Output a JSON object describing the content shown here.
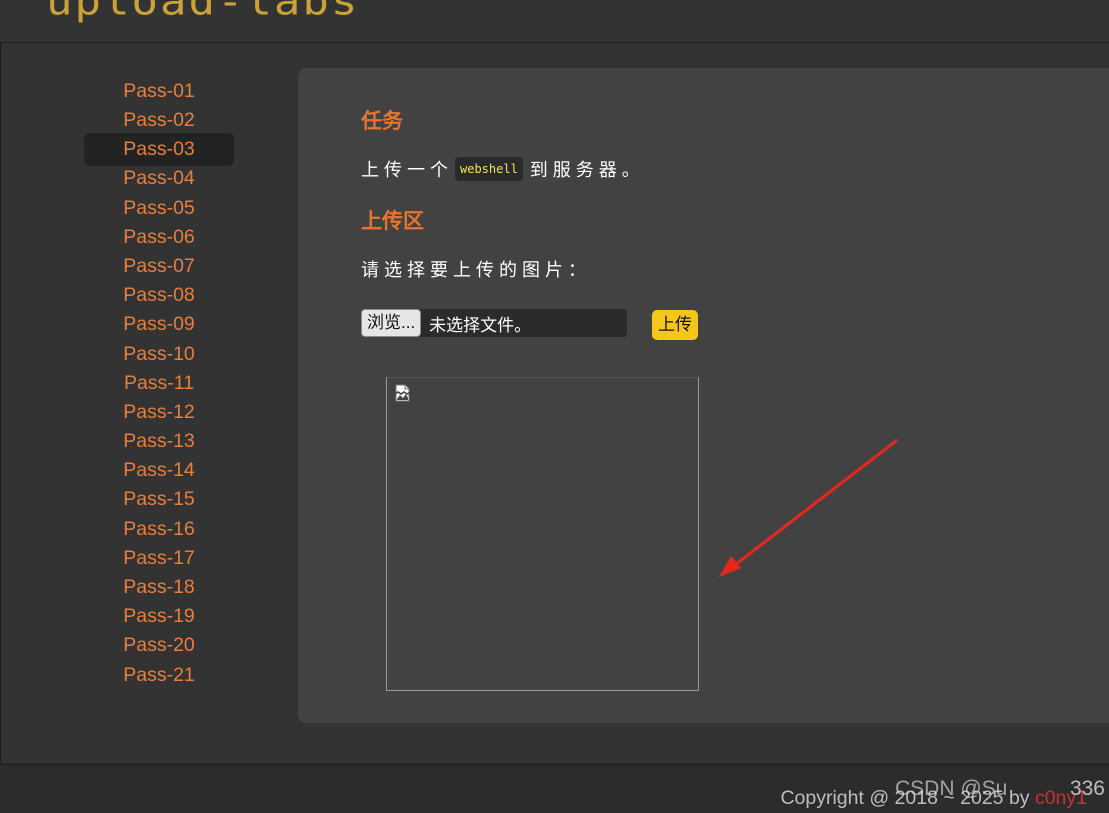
{
  "header": {
    "logo_text": "upload-labs"
  },
  "sidebar": {
    "items": [
      {
        "label": "Pass-01"
      },
      {
        "label": "Pass-02"
      },
      {
        "label": "Pass-03"
      },
      {
        "label": "Pass-04"
      },
      {
        "label": "Pass-05"
      },
      {
        "label": "Pass-06"
      },
      {
        "label": "Pass-07"
      },
      {
        "label": "Pass-08"
      },
      {
        "label": "Pass-09"
      },
      {
        "label": "Pass-10"
      },
      {
        "label": "Pass-11"
      },
      {
        "label": "Pass-12"
      },
      {
        "label": "Pass-13"
      },
      {
        "label": "Pass-14"
      },
      {
        "label": "Pass-15"
      },
      {
        "label": "Pass-16"
      },
      {
        "label": "Pass-17"
      },
      {
        "label": "Pass-18"
      },
      {
        "label": "Pass-19"
      },
      {
        "label": "Pass-20"
      },
      {
        "label": "Pass-21"
      }
    ],
    "active_label": "Pass-03"
  },
  "task": {
    "heading": "任务",
    "text_before": "上传一个",
    "code": "webshell",
    "text_after": "到服务器。"
  },
  "upload": {
    "heading": "上传区",
    "choose_label": "请选择要上传的图片：",
    "browse_label": "浏览...",
    "no_file_text": "未选择文件。",
    "submit_label": "上传"
  },
  "preview": {
    "broken_image_icon": "broken-image-icon"
  },
  "annotation": {
    "arrow_color": "#e8261e"
  },
  "footer": {
    "copyright_prefix": "Copyright @ 2018 ~ 2025 by ",
    "author": "c0ny1",
    "watermark": "CSDN @Su",
    "watermark_number": "336"
  },
  "colors": {
    "accent_orange": "#e8742e",
    "link_orange": "#e87e3b",
    "submit_yellow": "#f6c61a",
    "code_yellow": "#f5e25a",
    "logo_gold": "#c9a33a"
  }
}
